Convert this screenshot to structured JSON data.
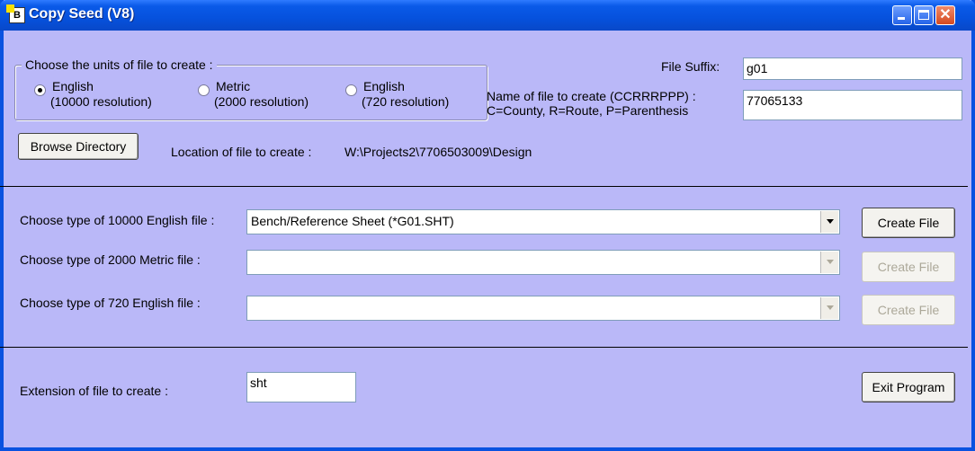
{
  "window": {
    "title": "Copy Seed (V8)"
  },
  "units_group": {
    "legend": "Choose the units of file to create :",
    "options": [
      {
        "line1": "English",
        "line2": "(10000 resolution)",
        "selected": true
      },
      {
        "line1": "Metric",
        "line2": "(2000 resolution)",
        "selected": false
      },
      {
        "line1": "English",
        "line2": "(720 resolution)",
        "selected": false
      }
    ]
  },
  "suffix": {
    "label": "File Suffix:",
    "value": "g01"
  },
  "filename": {
    "label1": "Name of file to create (CCRRRPPP) :",
    "label2": "C=County, R=Route, P=Parenthesis",
    "value": "77065133"
  },
  "browse": {
    "button_label": "Browse Directory",
    "location_label": "Location of file to create :",
    "location_value": "W:\\Projects2\\7706503009\\Design"
  },
  "file_types": [
    {
      "label": "Choose type of 10000 English file :",
      "value": "Bench/Reference Sheet (*G01.SHT)",
      "button": "Create File",
      "enabled": true
    },
    {
      "label": "Choose type of 2000 Metric file :",
      "value": "",
      "button": "Create File",
      "enabled": false
    },
    {
      "label": "Choose type of 720 English file :",
      "value": "",
      "button": "Create File",
      "enabled": false
    }
  ],
  "extension": {
    "label": "Extension of file to create :",
    "value": "sht"
  },
  "exit": {
    "label": "Exit Program"
  }
}
